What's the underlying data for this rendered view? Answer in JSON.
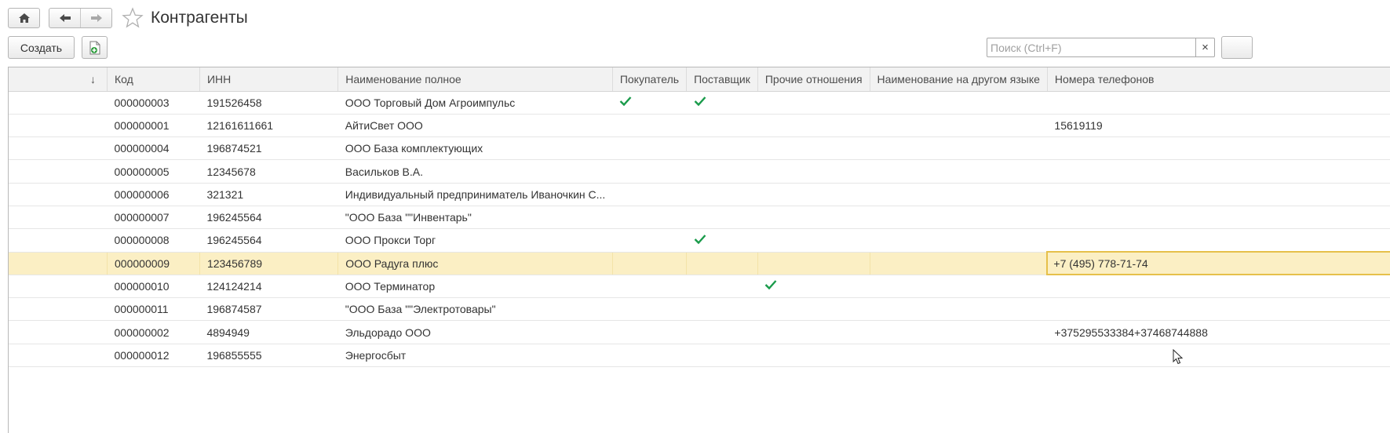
{
  "header": {
    "title": "Контрагенты",
    "home_icon": "home-icon",
    "back_icon": "arrow-left-icon",
    "forward_icon": "arrow-right-icon",
    "favorite_icon": "star-outline-icon"
  },
  "toolbar": {
    "create_label": "Создать",
    "copy_icon": "add-document-icon"
  },
  "search": {
    "placeholder": "Поиск (Ctrl+F)",
    "value": "",
    "clear_label": "×"
  },
  "table": {
    "sort_indicator": "↓",
    "columns": [
      "Код",
      "ИНН",
      "Наименование полное",
      "Покупатель",
      "Поставщик",
      "Прочие отношения",
      "Наименование на другом языке",
      "Номера телефонов"
    ],
    "rows": [
      {
        "code": "000000003",
        "inn": "191526458",
        "name": "ООО Торговый Дом Агроимпульс",
        "buyer": true,
        "supplier": true,
        "other": false,
        "alt_name": "",
        "phones": ""
      },
      {
        "code": "000000001",
        "inn": "12161611661",
        "name": "АйтиСвет ООО",
        "buyer": false,
        "supplier": false,
        "other": false,
        "alt_name": "",
        "phones": "15619119"
      },
      {
        "code": "000000004",
        "inn": "196874521",
        "name": "ООО База комплектующих",
        "buyer": false,
        "supplier": false,
        "other": false,
        "alt_name": "",
        "phones": ""
      },
      {
        "code": "000000005",
        "inn": "12345678",
        "name": "Васильков В.А.",
        "buyer": false,
        "supplier": false,
        "other": false,
        "alt_name": "",
        "phones": ""
      },
      {
        "code": "000000006",
        "inn": "321321",
        "name": "Индивидуальный предприниматель Иваночкин С...",
        "buyer": false,
        "supplier": false,
        "other": false,
        "alt_name": "",
        "phones": ""
      },
      {
        "code": "000000007",
        "inn": "196245564",
        "name": "\"ООО База \"\"Инвентарь\"",
        "buyer": false,
        "supplier": false,
        "other": false,
        "alt_name": "",
        "phones": ""
      },
      {
        "code": "000000008",
        "inn": "196245564",
        "name": "ООО Прокси Торг",
        "buyer": false,
        "supplier": true,
        "other": false,
        "alt_name": "",
        "phones": ""
      },
      {
        "code": "000000009",
        "inn": "123456789",
        "name": "ООО Радуга плюс",
        "buyer": false,
        "supplier": false,
        "other": false,
        "alt_name": "",
        "phones": "+7 (495) 778-71-74",
        "selected": true
      },
      {
        "code": "000000010",
        "inn": "124124214",
        "name": "ООО Терминатор",
        "buyer": false,
        "supplier": false,
        "other": true,
        "alt_name": "",
        "phones": ""
      },
      {
        "code": "000000011",
        "inn": "196874587",
        "name": "\"ООО База \"\"Электротовары\"",
        "buyer": false,
        "supplier": false,
        "other": false,
        "alt_name": "",
        "phones": ""
      },
      {
        "code": "000000002",
        "inn": "4894949",
        "name": "Эльдорадо ООО",
        "buyer": false,
        "supplier": false,
        "other": false,
        "alt_name": "",
        "phones": "+375295533384+37468744888"
      },
      {
        "code": "000000012",
        "inn": "196855555",
        "name": "Энергосбыт",
        "buyer": false,
        "supplier": false,
        "other": false,
        "alt_name": "",
        "phones": ""
      }
    ]
  },
  "colors": {
    "check": "#1a9b4b",
    "selected_row": "#fbefc4",
    "active_cell_border": "#e6c04a",
    "header_bg": "#f2f2f2"
  }
}
